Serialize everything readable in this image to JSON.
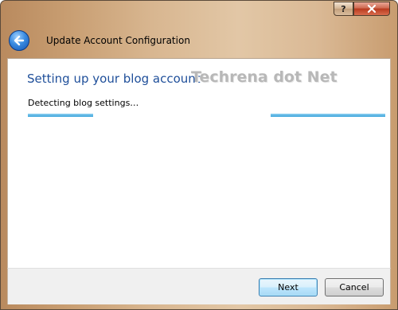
{
  "window": {
    "title_controls": {
      "help_label": "?",
      "close_icon": "close-x-icon"
    },
    "header": {
      "back_icon": "back-arrow-icon",
      "title": "Update Account Configuration"
    }
  },
  "content": {
    "heading": "Setting up your blog account",
    "watermark": "Techrena dot Net",
    "status": "Detecting blog settings…",
    "progress": {
      "style": "marquee",
      "color": "#3aa3dc"
    }
  },
  "footer": {
    "next_label": "Next",
    "cancel_label": "Cancel"
  },
  "colors": {
    "heading": "#1f4f9a",
    "close_button": "#c8452a",
    "accent_button_border": "#3c7fb1"
  }
}
